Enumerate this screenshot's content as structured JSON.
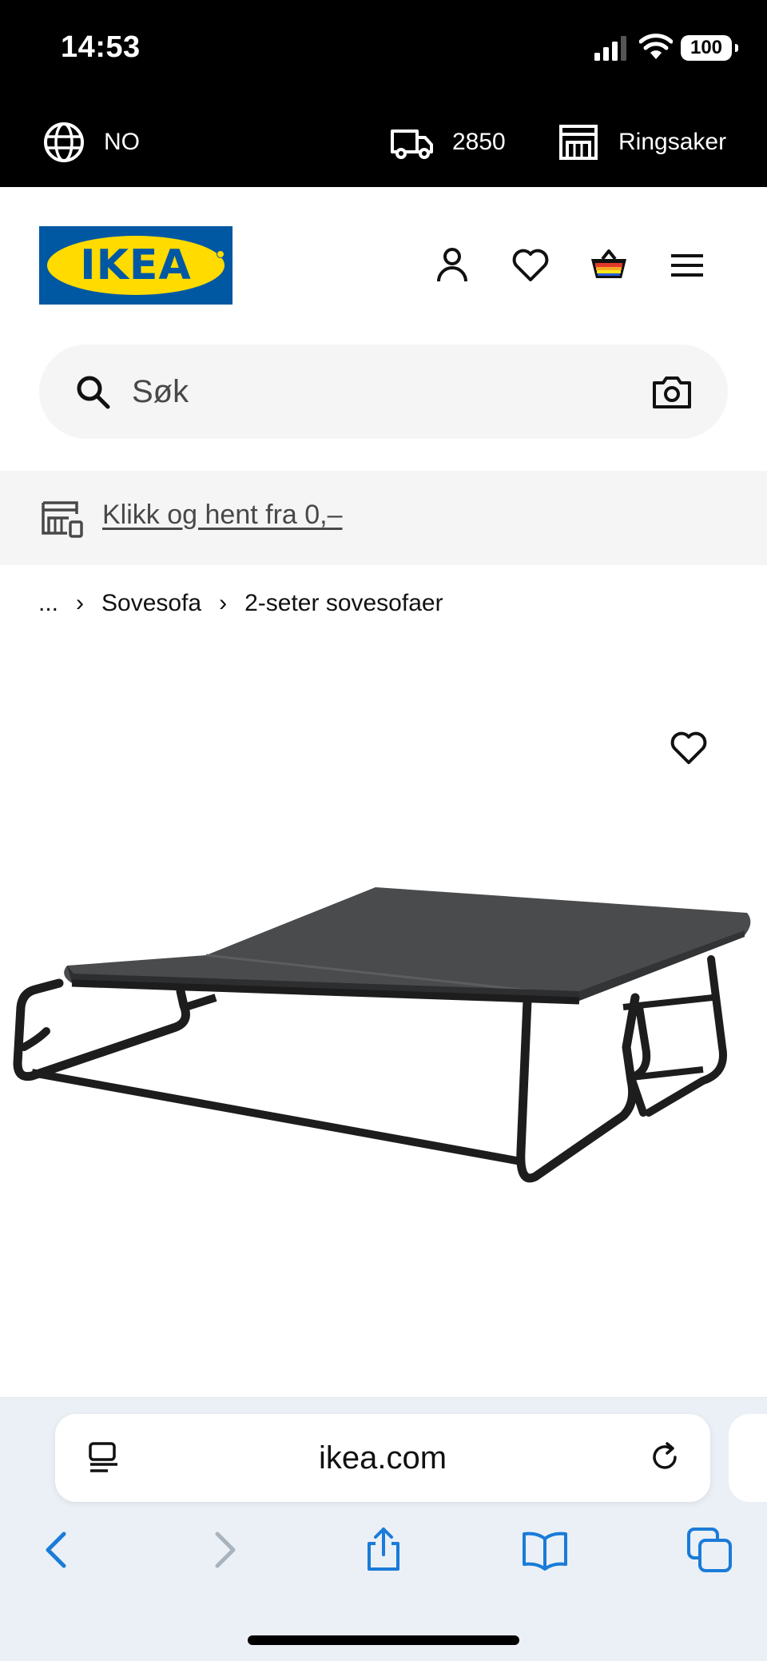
{
  "status_bar": {
    "time": "14:53",
    "battery": "100"
  },
  "info_bar": {
    "language": "NO",
    "postcode": "2850",
    "store": "Ringsaker"
  },
  "header": {
    "logo_text": "IKEA"
  },
  "search": {
    "placeholder": "Søk"
  },
  "promo": {
    "link_text": "Klikk og hent fra 0,–"
  },
  "breadcrumb": {
    "ellipsis": "...",
    "items": [
      "Sovesofa",
      "2-seter sovesofaer"
    ]
  },
  "browser": {
    "url": "ikea.com"
  },
  "colors": {
    "ikea_blue": "#0058a3",
    "ikea_yellow": "#ffdb00",
    "safari_blue": "#1a7bd8"
  },
  "icons": {
    "language": "globe-icon",
    "delivery": "truck-icon",
    "store": "store-icon",
    "account": "user-icon",
    "favourites": "heart-icon",
    "cart": "shopping-bag-icon",
    "menu": "hamburger-menu-icon",
    "search": "search-icon",
    "visual_search": "camera-icon"
  }
}
